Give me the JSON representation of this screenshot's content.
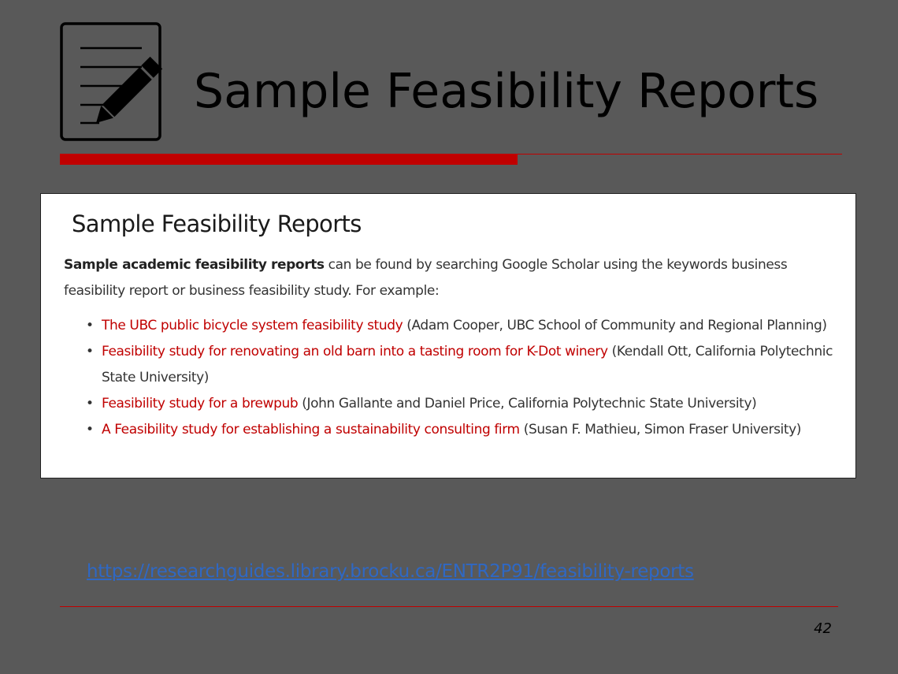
{
  "slide": {
    "title": "Sample Feasibility Reports",
    "icon": "edit-document-icon",
    "accent_color": "#c00000",
    "background_color": "#595959",
    "page_number": "42",
    "url": "https://researchguides.library.brocku.ca/ENTR2P91/feasibility-reports"
  },
  "content": {
    "heading": "Sample Feasibility Reports",
    "intro_bold": "Sample academic feasibility reports",
    "intro_text": " can be found by searching Google Scholar using the keywords business feasibility report  or business feasibility study. For example:",
    "items": [
      {
        "link": "The UBC public bicycle system feasibility study",
        "details": " (Adam Cooper, UBC School of Community and Regional Planning)"
      },
      {
        "link": "Feasibility study for renovating an old barn into a tasting room for K-Dot winery",
        "details": " (Kendall Ott, California Polytechnic State University)"
      },
      {
        "link": "Feasibility study for a brewpub",
        "details": " (John Gallante and Daniel Price, California Polytechnic State University)"
      },
      {
        "link": "A Feasibility study for establishing a sustainability consulting firm",
        "details": " (Susan F. Mathieu, Simon Fraser University)"
      }
    ],
    "bullet": "•"
  }
}
